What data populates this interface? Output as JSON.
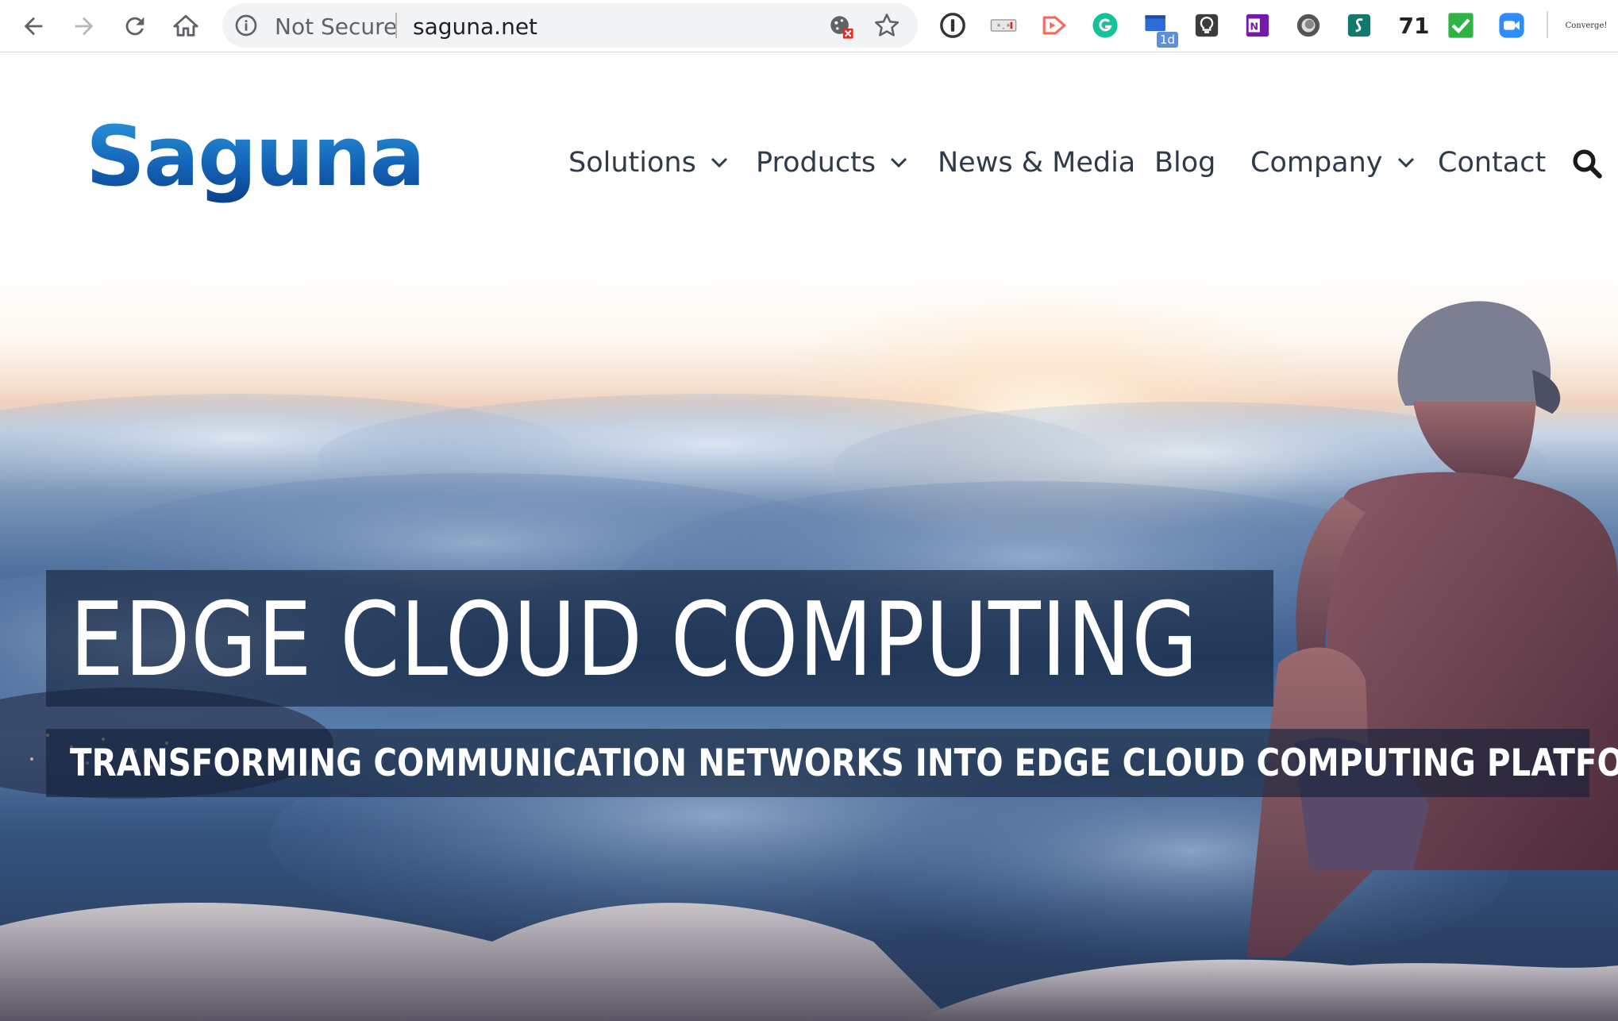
{
  "browser": {
    "security_label": "Not Secure",
    "url": "saguna.net",
    "extension_count": "71",
    "extension_badge": "1d",
    "converge_label": "Converge!"
  },
  "site": {
    "logo_text": "Saguna",
    "nav": {
      "solutions": "Solutions",
      "products": "Products",
      "news_media": "News & Media",
      "blog": "Blog",
      "company": "Company",
      "contact": "Contact"
    }
  },
  "hero": {
    "title": "EDGE CLOUD COMPUTING",
    "subtitle": "TRANSFORMING COMMUNICATION NETWORKS INTO EDGE CLOUD COMPUTING PLATFORMS"
  },
  "colors": {
    "brand_blue": "#1b6fc0",
    "nav_text": "#2f3a4a",
    "overlay": "rgba(18,32,56,0.62)"
  },
  "icons": [
    "back-arrow-icon",
    "forward-arrow-icon",
    "reload-icon",
    "home-icon",
    "info-icon",
    "cookie-blocked-icon",
    "star-icon",
    "1password-icon",
    "ip-icon",
    "cast-icon",
    "grammarly-icon",
    "screen-capture-icon",
    "idea-icon",
    "onenote-icon",
    "circle-icon",
    "s-extension-icon",
    "checkmark-icon",
    "zoom-icon",
    "search-icon",
    "chevron-down-icon"
  ]
}
